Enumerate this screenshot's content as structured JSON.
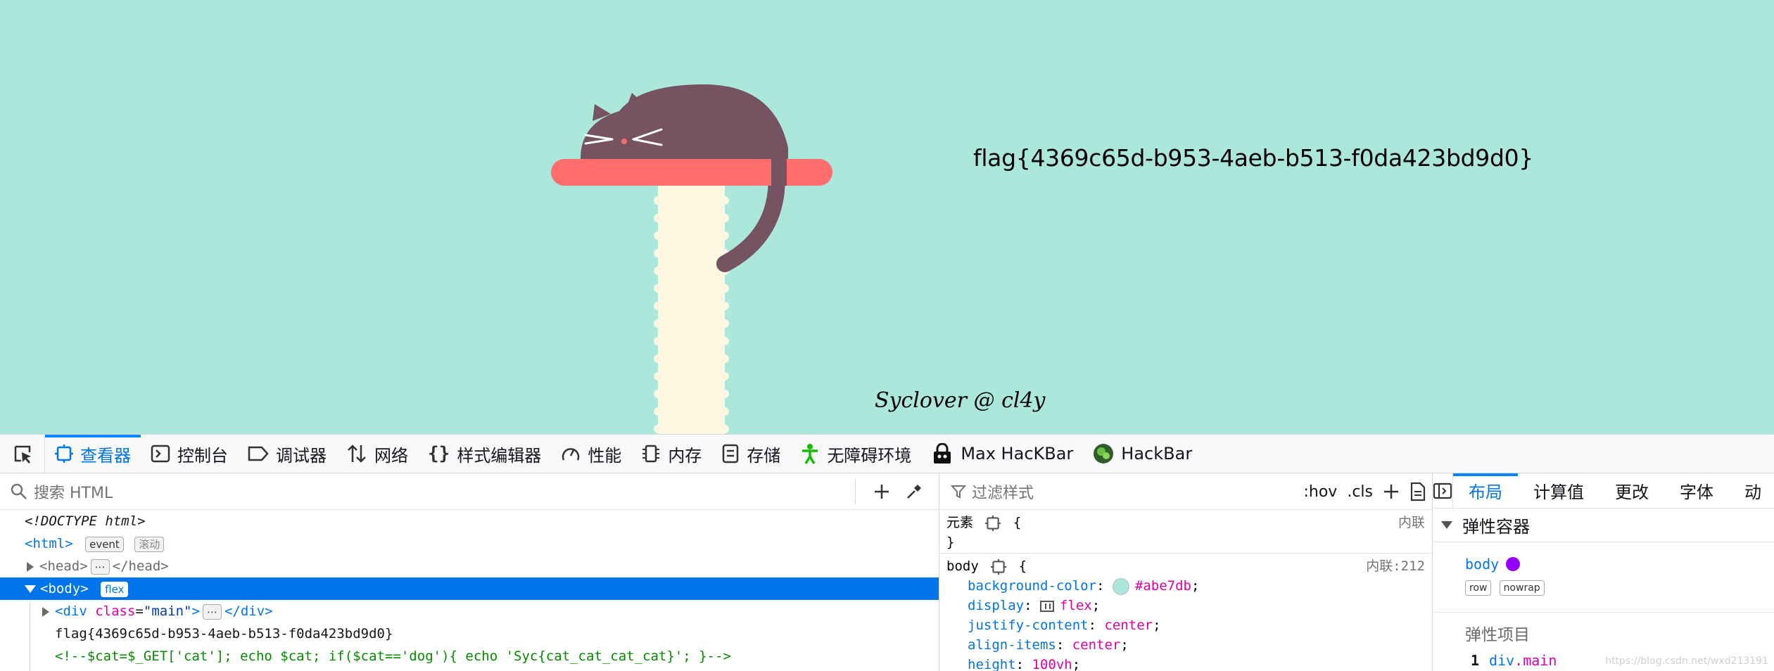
{
  "page": {
    "background_color": "#abe7db",
    "flag_text": "flag{4369c65d-b953-4aeb-b513-f0da423bd9d0}",
    "signature": "Syclover @ cl4y"
  },
  "toolbar": {
    "tabs": [
      {
        "label": "查看器",
        "icon": "inspector-icon",
        "active": true
      },
      {
        "label": "控制台",
        "icon": "console-icon"
      },
      {
        "label": "调试器",
        "icon": "debugger-icon"
      },
      {
        "label": "网络",
        "icon": "network-icon"
      },
      {
        "label": "样式编辑器",
        "icon": "style-editor-icon"
      },
      {
        "label": "性能",
        "icon": "performance-icon"
      },
      {
        "label": "内存",
        "icon": "memory-icon"
      },
      {
        "label": "存储",
        "icon": "storage-icon"
      },
      {
        "label": "无障碍环境",
        "icon": "accessibility-icon"
      },
      {
        "label": "Max HacKBar",
        "icon": "max-hackbar-icon"
      },
      {
        "label": "HackBar",
        "icon": "hackbar-icon"
      }
    ]
  },
  "inspector": {
    "search_placeholder": "搜索 HTML",
    "doctype": "<!DOCTYPE html>",
    "html_open": "<html>",
    "html_badge_event": "event",
    "html_badge_scroll": "滚动",
    "head_open": "<head>",
    "head_close": "</head>",
    "ellipsis": "⋯",
    "body_open": "<body>",
    "body_badge": "flex",
    "div_open_tag": "<div",
    "div_attr_name": "class",
    "div_attr_eq": "=",
    "div_attr_value": "\"main\"",
    "div_open_close": ">",
    "div_close": "</div>",
    "flag_text_node": "flag{4369c65d-b953-4aeb-b513-f0da423bd9d0}",
    "comment": "<!--$cat=$_GET['cat']; echo $cat; if($cat=='dog'){ echo 'Syc{cat_cat_cat_cat}'; }-->"
  },
  "rules": {
    "filter_placeholder": "过滤样式",
    "hov": ":hov",
    "cls": ".cls",
    "element_selector": "元素",
    "open_brace": "{",
    "close_brace": "}",
    "element_source": "内联",
    "body_selector": "body",
    "body_source": "内联:212",
    "declarations": [
      {
        "prop": "background-color",
        "value": "#abe7db"
      },
      {
        "prop": "display",
        "value": "flex"
      },
      {
        "prop": "justify-content",
        "value": "center"
      },
      {
        "prop": "align-items",
        "value": "center"
      },
      {
        "prop": "height",
        "value": "100vh"
      }
    ]
  },
  "layout_panel": {
    "tabs": [
      "布局",
      "计算值",
      "更改",
      "字体",
      "动"
    ],
    "flex_container_title": "弹性容器",
    "container_name": "body",
    "container_color": "#9400ff",
    "badges": [
      "row",
      "nowrap"
    ],
    "flex_items_title": "弹性项目",
    "item_index": "1",
    "item_name": "div",
    "item_class": ".main"
  },
  "watermark": "https://blog.csdn.net/wxd213191"
}
